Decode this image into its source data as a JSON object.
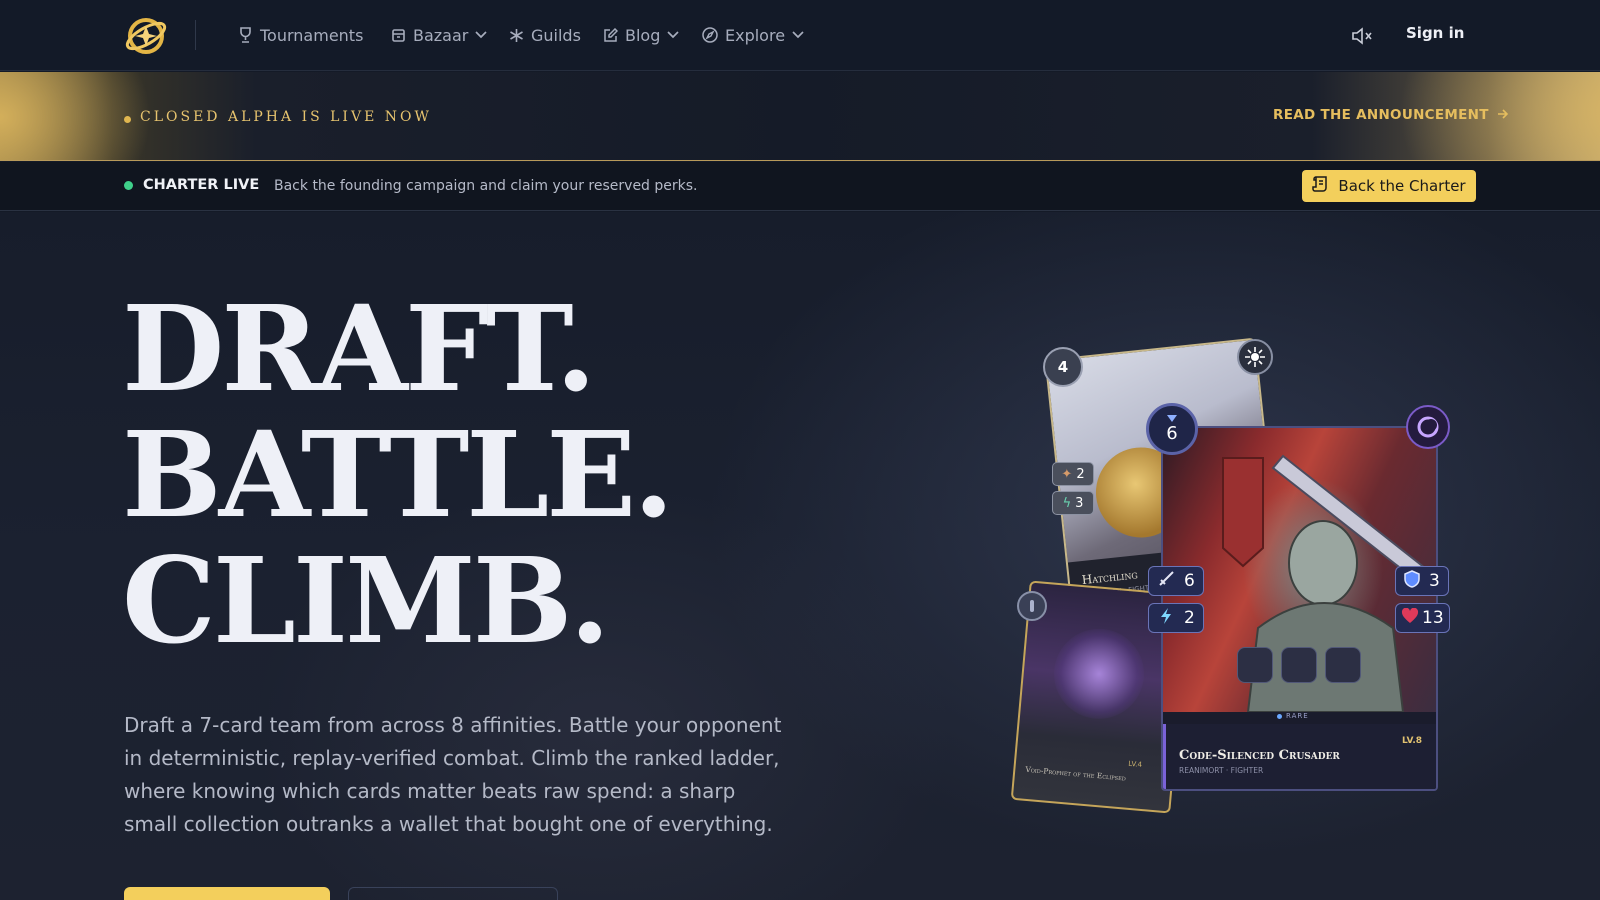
{
  "nav": {
    "items": [
      {
        "label": "Tournaments",
        "icon": "trophy-icon",
        "dropdown": false
      },
      {
        "label": "Bazaar",
        "icon": "shop-icon",
        "dropdown": true
      },
      {
        "label": "Guilds",
        "icon": "sparkle-icon",
        "dropdown": false
      },
      {
        "label": "Blog",
        "icon": "edit-icon",
        "dropdown": true
      },
      {
        "label": "Explore",
        "icon": "compass-icon",
        "dropdown": true
      }
    ],
    "sign_in": "Sign in",
    "mute_icon": "speaker-muted-icon"
  },
  "alpha_banner": {
    "text": "CLOSED ALPHA IS LIVE NOW",
    "link": "READ THE ANNOUNCEMENT"
  },
  "charter": {
    "status": "CHARTER LIVE",
    "message": "Back the founding campaign and claim your reserved perks.",
    "button": "Back the Charter"
  },
  "hero": {
    "headline": [
      "DRAFT.",
      "BATTLE.",
      "CLIMB."
    ],
    "description": "Draft a 7-card team from across 8 affinities. Battle your opponent in deterministic, replay-verified combat. Climb the ranked ladder, where knowing which cards matter beats raw spend: a sharp small collection outranks a wallet that bought one of everything."
  },
  "cards": {
    "back": {
      "cost": "4",
      "name": "Hatchling",
      "subtitle": "CELESTIAN · FIGHTER",
      "stats": [
        "2",
        "3"
      ]
    },
    "left": {
      "name": "Void-Prophet of the Eclipsed",
      "level": "LV.4"
    },
    "front": {
      "cost": "6",
      "name": "Code-Silenced Crusader",
      "subtitle": "REANIMORT · FIGHTER",
      "rarity": "RARE",
      "level": "LV.8",
      "attack": "6",
      "speed": "2",
      "armor": "3",
      "health": "13"
    }
  },
  "colors": {
    "accent": "#f3cf5c",
    "gold": "#e6c36e",
    "live": "#3fd08a",
    "background": "#141a27"
  }
}
